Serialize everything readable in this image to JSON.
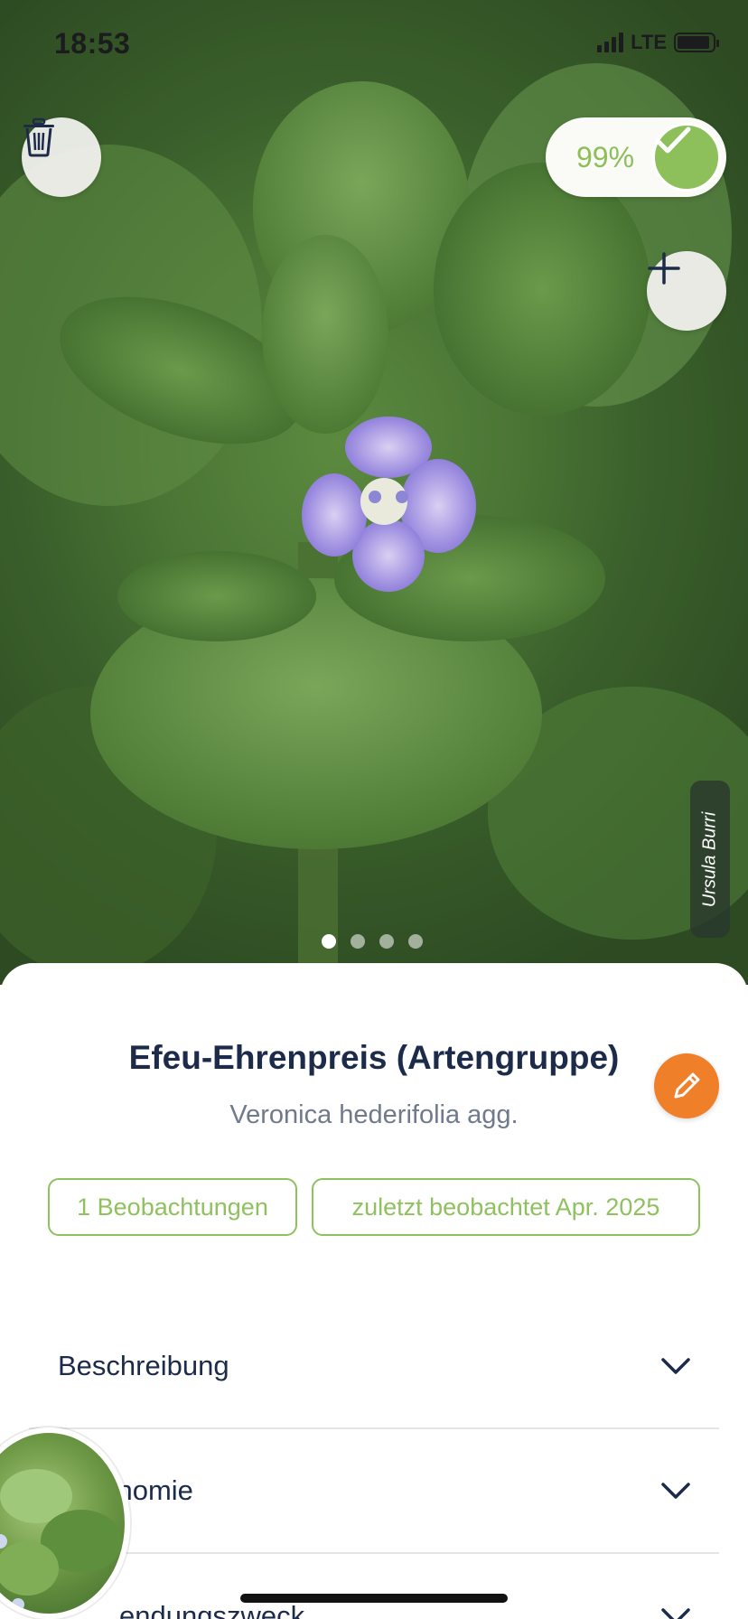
{
  "status_bar": {
    "time": "18:53",
    "network": "LTE"
  },
  "photo": {
    "confidence": "99%",
    "credit": "Ursula Burri",
    "page_count": 4,
    "active_page": 0,
    "icons": {
      "delete": "trash-icon",
      "add": "plus-icon",
      "confirmed": "checkmark-icon"
    }
  },
  "species": {
    "common_name": "Efeu-Ehrenpreis (Artengruppe)",
    "scientific_name": "Veronica hederifolia agg.",
    "edit_icon": "pencil-icon"
  },
  "chips": {
    "observations": "1 Beobachtungen",
    "last_observed": "zuletzt beobachtet Apr. 2025"
  },
  "sections": [
    {
      "label": "Beschreibung"
    },
    {
      "label": "Taxonomie"
    },
    {
      "label": "endungszweck"
    }
  ],
  "colors": {
    "accent_green": "#8fc15f",
    "edit_orange": "#f07f2a",
    "title_navy": "#1d2b4a"
  }
}
